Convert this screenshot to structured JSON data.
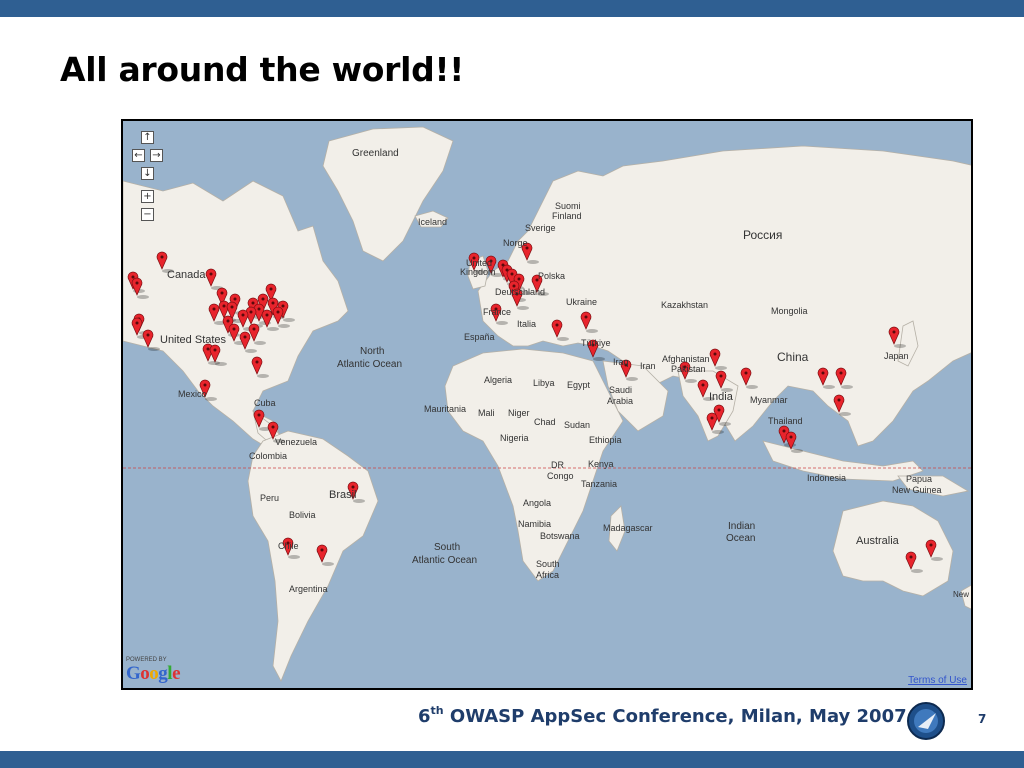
{
  "slide": {
    "title": "All around the world!!",
    "footer_number": "6",
    "footer_sup": "th",
    "footer_rest": " OWASP AppSec Conference, Milan, May 2007",
    "page_number": "7"
  },
  "map": {
    "powered_by": "POWERED BY",
    "google": "Google",
    "terms": "Terms of Use",
    "controls": {
      "up": "↑",
      "left": "←",
      "right": "→",
      "down": "↓",
      "zoom_in": "+",
      "zoom_out": "−"
    },
    "labels": [
      {
        "id": "greenland",
        "text": "Greenland"
      },
      {
        "id": "iceland",
        "text": "Iceland"
      },
      {
        "id": "suomi",
        "text": "Suomi"
      },
      {
        "id": "finland",
        "text": "Finland"
      },
      {
        "id": "sverige",
        "text": "Sverige"
      },
      {
        "id": "norge",
        "text": "Norge"
      },
      {
        "id": "rossiya",
        "text": "Россия"
      },
      {
        "id": "united",
        "text": "United"
      },
      {
        "id": "kingdom",
        "text": "Kingdom"
      },
      {
        "id": "polska",
        "text": "Polska"
      },
      {
        "id": "deutschland",
        "text": "Deutschland"
      },
      {
        "id": "ukraine",
        "text": "Ukraine"
      },
      {
        "id": "kazakhstan",
        "text": "Kazakhstan"
      },
      {
        "id": "mongolia",
        "text": "Mongolia"
      },
      {
        "id": "france",
        "text": "France"
      },
      {
        "id": "italia",
        "text": "Italia"
      },
      {
        "id": "espana",
        "text": "España"
      },
      {
        "id": "turkiye",
        "text": "Türkiye"
      },
      {
        "id": "china",
        "text": "China"
      },
      {
        "id": "canada",
        "text": "Canada"
      },
      {
        "id": "usa",
        "text": "United States"
      },
      {
        "id": "north",
        "text": "North"
      },
      {
        "id": "atlantic",
        "text": "Atlantic Ocean"
      },
      {
        "id": "iraq",
        "text": "Iraq"
      },
      {
        "id": "iran",
        "text": "Iran"
      },
      {
        "id": "afghanistan",
        "text": "Afghanistan"
      },
      {
        "id": "pakistan",
        "text": "Pakistan"
      },
      {
        "id": "japan",
        "text": "Japan"
      },
      {
        "id": "algeria",
        "text": "Algeria"
      },
      {
        "id": "libya",
        "text": "Libya"
      },
      {
        "id": "egypt",
        "text": "Egypt"
      },
      {
        "id": "saudi",
        "text": "Saudi"
      },
      {
        "id": "arabia",
        "text": "Arabia"
      },
      {
        "id": "india",
        "text": "India"
      },
      {
        "id": "myanmar",
        "text": "Myanmar"
      },
      {
        "id": "mexico",
        "text": "Mexico"
      },
      {
        "id": "cuba",
        "text": "Cuba"
      },
      {
        "id": "mauritania",
        "text": "Mauritania"
      },
      {
        "id": "mali",
        "text": "Mali"
      },
      {
        "id": "niger",
        "text": "Niger"
      },
      {
        "id": "chad",
        "text": "Chad"
      },
      {
        "id": "sudan",
        "text": "Sudan"
      },
      {
        "id": "thailand",
        "text": "Thailand"
      },
      {
        "id": "venezuela",
        "text": "Venezuela"
      },
      {
        "id": "colombia",
        "text": "Colombia"
      },
      {
        "id": "nigeria",
        "text": "Nigeria"
      },
      {
        "id": "ethiopia",
        "text": "Ethiopia"
      },
      {
        "id": "dr",
        "text": "DR"
      },
      {
        "id": "congo",
        "text": "Congo"
      },
      {
        "id": "kenya",
        "text": "Kenya"
      },
      {
        "id": "tanzania",
        "text": "Tanzania"
      },
      {
        "id": "indonesia",
        "text": "Indonesia"
      },
      {
        "id": "papua",
        "text": "Papua"
      },
      {
        "id": "newguinea",
        "text": "New Guinea"
      },
      {
        "id": "peru",
        "text": "Peru"
      },
      {
        "id": "brasil",
        "text": "Brasil"
      },
      {
        "id": "bolivia",
        "text": "Bolivia"
      },
      {
        "id": "angola",
        "text": "Angola"
      },
      {
        "id": "namibia",
        "text": "Namibia"
      },
      {
        "id": "botswana",
        "text": "Botswana"
      },
      {
        "id": "madagascar",
        "text": "Madagascar"
      },
      {
        "id": "indian",
        "text": "Indian"
      },
      {
        "id": "ocean",
        "text": "Ocean"
      },
      {
        "id": "chile",
        "text": "Chile"
      },
      {
        "id": "south",
        "text": "South"
      },
      {
        "id": "satlantic",
        "text": "Atlantic Ocean"
      },
      {
        "id": "southafrica1",
        "text": "South"
      },
      {
        "id": "southafrica2",
        "text": "Africa"
      },
      {
        "id": "australia",
        "text": "Australia"
      },
      {
        "id": "argentina",
        "text": "Argentina"
      },
      {
        "id": "nz",
        "text": "New"
      }
    ],
    "marker_color": "#e8242c"
  }
}
